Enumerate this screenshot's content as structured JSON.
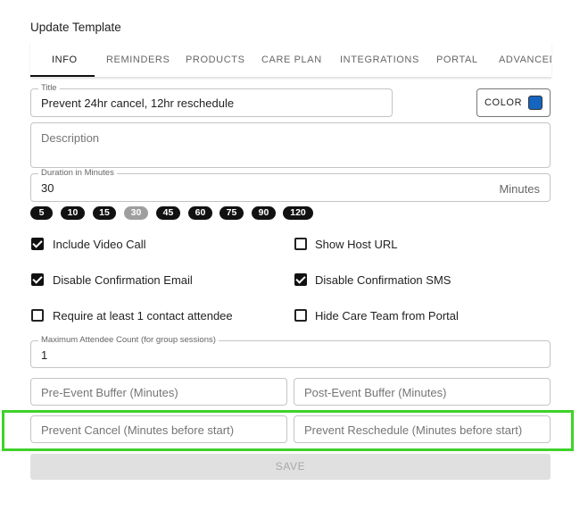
{
  "header": {
    "title": "Update Template"
  },
  "tabs": [
    {
      "label": "INFO",
      "active": true
    },
    {
      "label": "REMINDERS"
    },
    {
      "label": "PRODUCTS"
    },
    {
      "label": "CARE PLAN"
    },
    {
      "label": "INTEGRATIONS"
    },
    {
      "label": "PORTAL"
    },
    {
      "label": "ADVANCED"
    }
  ],
  "form": {
    "title": {
      "label": "Title",
      "value": "Prevent 24hr cancel, 12hr reschedule"
    },
    "color_button": {
      "label": "COLOR",
      "swatch_color": "#1565c0"
    },
    "description": {
      "placeholder": "Description"
    },
    "duration": {
      "label": "Duration in Minutes",
      "value": "30",
      "suffix": "Minutes"
    },
    "duration_chips": [
      "5",
      "10",
      "15",
      "30",
      "45",
      "60",
      "75",
      "90",
      "120"
    ],
    "checkboxes": [
      {
        "label": "Include Video Call",
        "checked": true
      },
      {
        "label": "Show Host URL",
        "checked": false
      },
      {
        "label": "Disable Confirmation Email",
        "checked": true
      },
      {
        "label": "Disable Confirmation SMS",
        "checked": true
      },
      {
        "label": "Require at least 1 contact attendee",
        "checked": false
      },
      {
        "label": "Hide Care Team from Portal",
        "checked": false
      }
    ],
    "max_attendees": {
      "label": "Maximum Attendee Count (for group sessions)",
      "value": "1"
    },
    "pre_buffer": {
      "placeholder": "Pre-Event Buffer (Minutes)"
    },
    "post_buffer": {
      "placeholder": "Post-Event Buffer (Minutes)"
    },
    "prevent_cancel": {
      "placeholder": "Prevent Cancel (Minutes before start)"
    },
    "prevent_reschedule": {
      "placeholder": "Prevent Reschedule (Minutes before start)"
    },
    "save_label": "SAVE"
  },
  "colors": {
    "highlight": "#3fd22a",
    "accent": "#111111"
  }
}
